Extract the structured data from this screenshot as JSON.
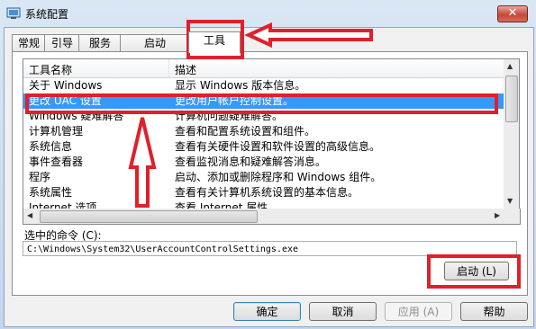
{
  "window": {
    "title": "系统配置",
    "close_glyph": "✕"
  },
  "tabs": [
    {
      "label": "常规"
    },
    {
      "label": "引导"
    },
    {
      "label": "服务"
    },
    {
      "label": "启动"
    },
    {
      "label": "工具"
    }
  ],
  "tools_list": {
    "columns": [
      "工具名称",
      "描述"
    ],
    "rows": [
      {
        "name": "关于 Windows",
        "desc": "显示 Windows 版本信息。"
      },
      {
        "name": "更改 UAC 设置",
        "desc": "更改用户帐户控制设置。"
      },
      {
        "name": "Windows 疑难解答",
        "desc": "计算机问题疑难解答。"
      },
      {
        "name": "计算机管理",
        "desc": "查看和配置系统设置和组件。"
      },
      {
        "name": "系统信息",
        "desc": "查看有关硬件设置和软件设置的高级信息。"
      },
      {
        "name": "事件查看器",
        "desc": "查看监视消息和疑难解答消息。"
      },
      {
        "name": "程序",
        "desc": "启动、添加或删除程序和 Windows 组件。"
      },
      {
        "name": "系统属性",
        "desc": "查看有关计算机系统设置的基本信息。"
      },
      {
        "name": "Internet 选项",
        "desc": "查看 Internet 属性。"
      }
    ],
    "selected_index": 1
  },
  "command": {
    "label": "选中的命令 (C):",
    "value": "C:\\Windows\\System32\\UserAccountControlSettings.exe"
  },
  "buttons": {
    "launch": "启动 (L)",
    "ok": "确定",
    "cancel": "取消",
    "apply": "应用 (A)",
    "help": "帮助"
  },
  "colors": {
    "annotation": "#e0202a",
    "selection": "#3399ff"
  }
}
